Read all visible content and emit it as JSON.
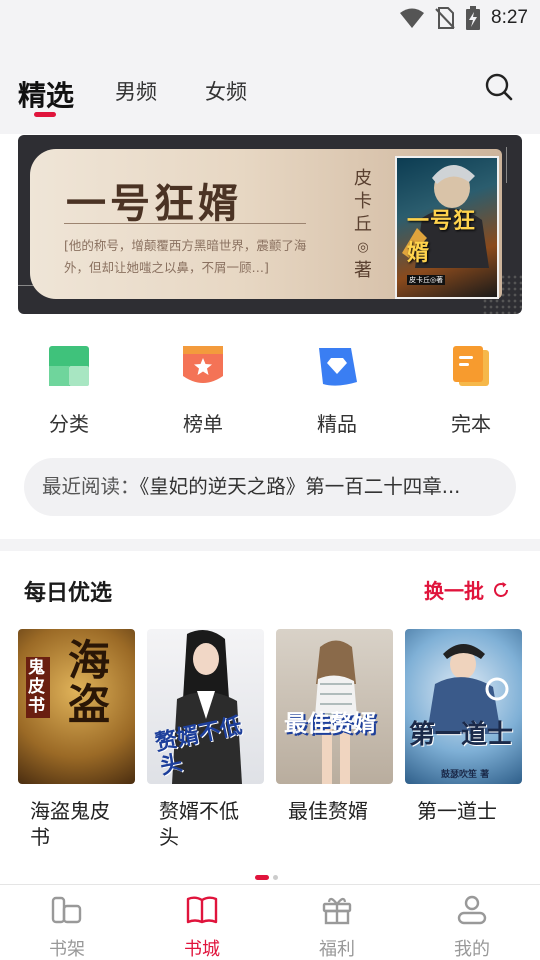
{
  "status_bar": {
    "time": "8:27"
  },
  "top_tabs": [
    {
      "label": "精选",
      "active": true
    },
    {
      "label": "男频",
      "active": false
    },
    {
      "label": "女频",
      "active": false
    }
  ],
  "banner": {
    "title": "一号狂婿",
    "description": "[他的称号，增颠覆西方黑暗世界，震颤了海外，但却让她嗤之以鼻，不屑一顾…]",
    "author_vertical": [
      "皮",
      "卡",
      "丘",
      "◎",
      "著"
    ],
    "cover_title": "一号狂婿",
    "cover_author": "皮卡丘◎著"
  },
  "quick_menu": [
    {
      "label": "分类",
      "icon": "category-icon"
    },
    {
      "label": "榜单",
      "icon": "ranking-icon"
    },
    {
      "label": "精品",
      "icon": "diamond-icon"
    },
    {
      "label": "完本",
      "icon": "finished-book-icon"
    }
  ],
  "recent": {
    "label": "最近阅读：",
    "text": "《皇妃的逆天之路》第一百二十四章..."
  },
  "daily": {
    "title": "每日优选",
    "refresh_label": "换一批",
    "books": [
      {
        "title": "海盗鬼皮书",
        "cover_text": "海盗",
        "cover_sub": "鬼皮书"
      },
      {
        "title": "赘婿不低头",
        "cover_text": "赘婿不低头"
      },
      {
        "title": "最佳赘婿",
        "cover_text": "最佳赘婿"
      },
      {
        "title": "第一道士",
        "cover_text": "第一道士",
        "cover_sub": "鼓瑟吹笙 著"
      }
    ]
  },
  "bottom_nav": [
    {
      "label": "书架",
      "icon": "bookshelf-icon",
      "active": false
    },
    {
      "label": "书城",
      "icon": "book-open-icon",
      "active": true
    },
    {
      "label": "福利",
      "icon": "gift-icon",
      "active": false
    },
    {
      "label": "我的",
      "icon": "user-icon",
      "active": false
    }
  ],
  "colors": {
    "accent": "#e0143c"
  }
}
